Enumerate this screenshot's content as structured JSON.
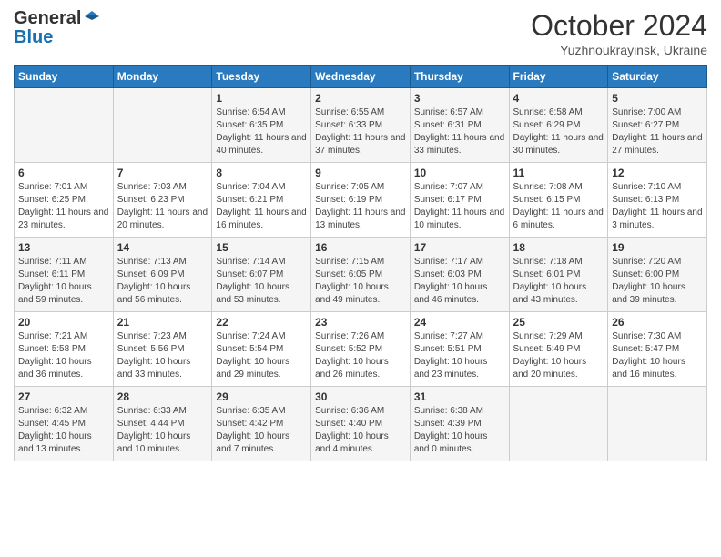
{
  "logo": {
    "general": "General",
    "blue": "Blue"
  },
  "header": {
    "month": "October 2024",
    "location": "Yuzhnoukrayinsk, Ukraine"
  },
  "days_of_week": [
    "Sunday",
    "Monday",
    "Tuesday",
    "Wednesday",
    "Thursday",
    "Friday",
    "Saturday"
  ],
  "weeks": [
    [
      {
        "day": "",
        "info": ""
      },
      {
        "day": "",
        "info": ""
      },
      {
        "day": "1",
        "info": "Sunrise: 6:54 AM\nSunset: 6:35 PM\nDaylight: 11 hours and 40 minutes."
      },
      {
        "day": "2",
        "info": "Sunrise: 6:55 AM\nSunset: 6:33 PM\nDaylight: 11 hours and 37 minutes."
      },
      {
        "day": "3",
        "info": "Sunrise: 6:57 AM\nSunset: 6:31 PM\nDaylight: 11 hours and 33 minutes."
      },
      {
        "day": "4",
        "info": "Sunrise: 6:58 AM\nSunset: 6:29 PM\nDaylight: 11 hours and 30 minutes."
      },
      {
        "day": "5",
        "info": "Sunrise: 7:00 AM\nSunset: 6:27 PM\nDaylight: 11 hours and 27 minutes."
      }
    ],
    [
      {
        "day": "6",
        "info": "Sunrise: 7:01 AM\nSunset: 6:25 PM\nDaylight: 11 hours and 23 minutes."
      },
      {
        "day": "7",
        "info": "Sunrise: 7:03 AM\nSunset: 6:23 PM\nDaylight: 11 hours and 20 minutes."
      },
      {
        "day": "8",
        "info": "Sunrise: 7:04 AM\nSunset: 6:21 PM\nDaylight: 11 hours and 16 minutes."
      },
      {
        "day": "9",
        "info": "Sunrise: 7:05 AM\nSunset: 6:19 PM\nDaylight: 11 hours and 13 minutes."
      },
      {
        "day": "10",
        "info": "Sunrise: 7:07 AM\nSunset: 6:17 PM\nDaylight: 11 hours and 10 minutes."
      },
      {
        "day": "11",
        "info": "Sunrise: 7:08 AM\nSunset: 6:15 PM\nDaylight: 11 hours and 6 minutes."
      },
      {
        "day": "12",
        "info": "Sunrise: 7:10 AM\nSunset: 6:13 PM\nDaylight: 11 hours and 3 minutes."
      }
    ],
    [
      {
        "day": "13",
        "info": "Sunrise: 7:11 AM\nSunset: 6:11 PM\nDaylight: 10 hours and 59 minutes."
      },
      {
        "day": "14",
        "info": "Sunrise: 7:13 AM\nSunset: 6:09 PM\nDaylight: 10 hours and 56 minutes."
      },
      {
        "day": "15",
        "info": "Sunrise: 7:14 AM\nSunset: 6:07 PM\nDaylight: 10 hours and 53 minutes."
      },
      {
        "day": "16",
        "info": "Sunrise: 7:15 AM\nSunset: 6:05 PM\nDaylight: 10 hours and 49 minutes."
      },
      {
        "day": "17",
        "info": "Sunrise: 7:17 AM\nSunset: 6:03 PM\nDaylight: 10 hours and 46 minutes."
      },
      {
        "day": "18",
        "info": "Sunrise: 7:18 AM\nSunset: 6:01 PM\nDaylight: 10 hours and 43 minutes."
      },
      {
        "day": "19",
        "info": "Sunrise: 7:20 AM\nSunset: 6:00 PM\nDaylight: 10 hours and 39 minutes."
      }
    ],
    [
      {
        "day": "20",
        "info": "Sunrise: 7:21 AM\nSunset: 5:58 PM\nDaylight: 10 hours and 36 minutes."
      },
      {
        "day": "21",
        "info": "Sunrise: 7:23 AM\nSunset: 5:56 PM\nDaylight: 10 hours and 33 minutes."
      },
      {
        "day": "22",
        "info": "Sunrise: 7:24 AM\nSunset: 5:54 PM\nDaylight: 10 hours and 29 minutes."
      },
      {
        "day": "23",
        "info": "Sunrise: 7:26 AM\nSunset: 5:52 PM\nDaylight: 10 hours and 26 minutes."
      },
      {
        "day": "24",
        "info": "Sunrise: 7:27 AM\nSunset: 5:51 PM\nDaylight: 10 hours and 23 minutes."
      },
      {
        "day": "25",
        "info": "Sunrise: 7:29 AM\nSunset: 5:49 PM\nDaylight: 10 hours and 20 minutes."
      },
      {
        "day": "26",
        "info": "Sunrise: 7:30 AM\nSunset: 5:47 PM\nDaylight: 10 hours and 16 minutes."
      }
    ],
    [
      {
        "day": "27",
        "info": "Sunrise: 6:32 AM\nSunset: 4:45 PM\nDaylight: 10 hours and 13 minutes."
      },
      {
        "day": "28",
        "info": "Sunrise: 6:33 AM\nSunset: 4:44 PM\nDaylight: 10 hours and 10 minutes."
      },
      {
        "day": "29",
        "info": "Sunrise: 6:35 AM\nSunset: 4:42 PM\nDaylight: 10 hours and 7 minutes."
      },
      {
        "day": "30",
        "info": "Sunrise: 6:36 AM\nSunset: 4:40 PM\nDaylight: 10 hours and 4 minutes."
      },
      {
        "day": "31",
        "info": "Sunrise: 6:38 AM\nSunset: 4:39 PM\nDaylight: 10 hours and 0 minutes."
      },
      {
        "day": "",
        "info": ""
      },
      {
        "day": "",
        "info": ""
      }
    ]
  ]
}
